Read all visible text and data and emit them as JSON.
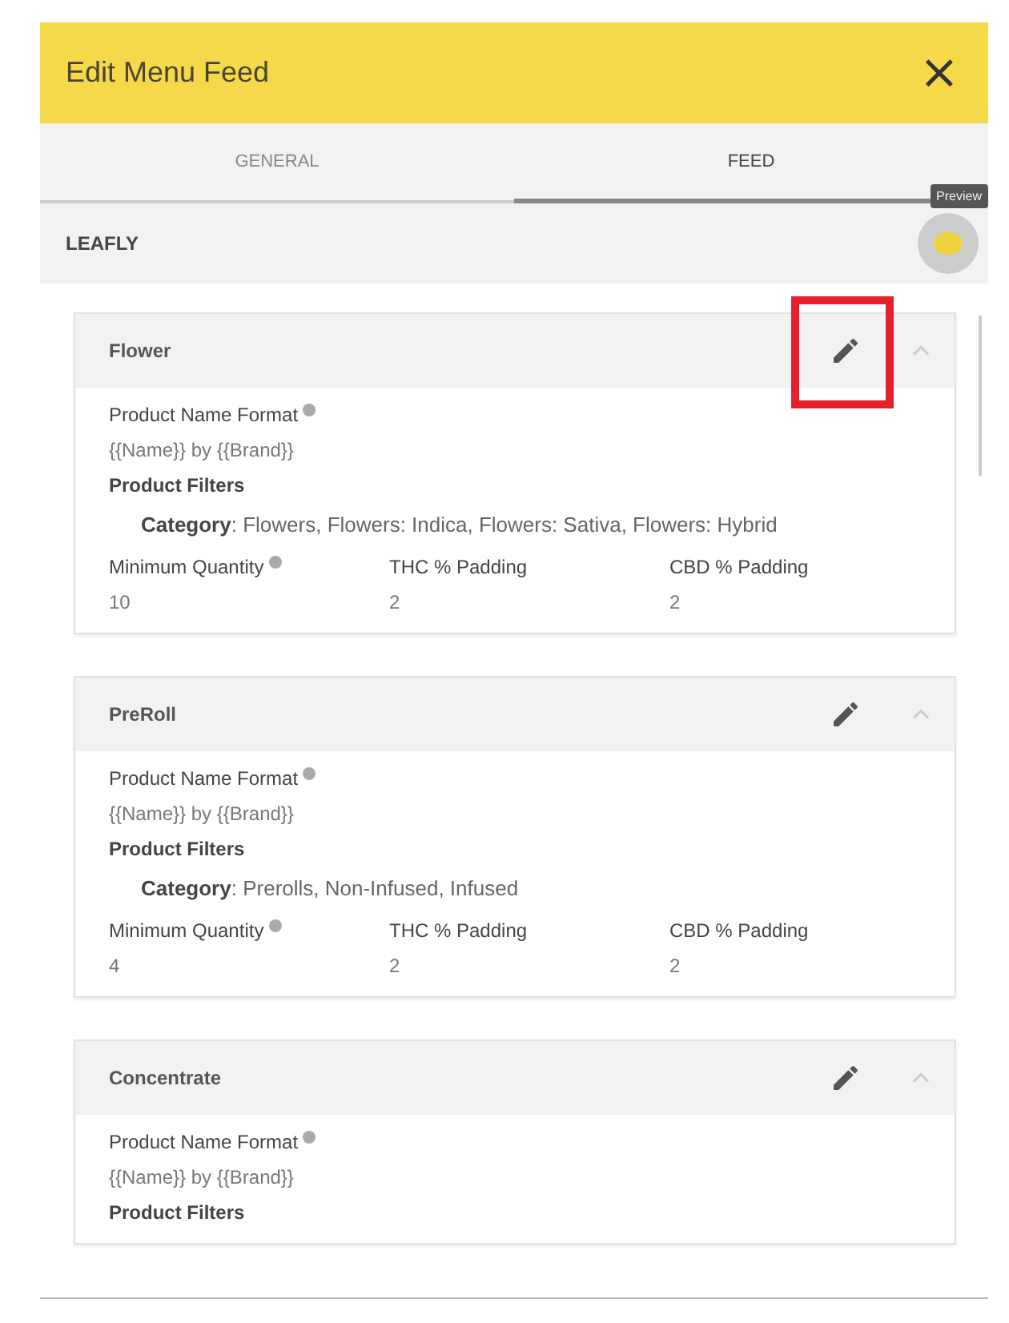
{
  "window": {
    "title": "Edit Menu Feed",
    "close": "×"
  },
  "tabs": [
    {
      "label": "GENERAL",
      "selected": false
    },
    {
      "label": "FEED",
      "selected": true
    }
  ],
  "section": {
    "title": "LEAFLY",
    "tooltip": "Preview"
  },
  "cards": [
    {
      "title": "Flower",
      "expanded": true,
      "edit_highlighted": true,
      "name_format_label": "Product Name Format",
      "name_format": "{{Name}} by {{Brand}}",
      "filters_label": "Product Filters",
      "filter": "**Category**: Flowers, Flowers: Indica, Flowers: Sativa, Flowers: Hybrid",
      "stats": [
        {
          "label": "Minimum Quantity",
          "info": true,
          "value": "10"
        },
        {
          "label": "THC % Padding",
          "info": false,
          "value": "2"
        },
        {
          "label": "CBD % Padding",
          "info": false,
          "value": "2"
        }
      ]
    },
    {
      "title": "PreRoll",
      "expanded": true,
      "edit_highlighted": false,
      "name_format_label": "Product Name Format",
      "name_format": "{{Name}} by {{Brand}}",
      "filters_label": "Product Filters",
      "filter": "**Category**: Prerolls, Non-Infused, Infused",
      "stats": [
        {
          "label": "Minimum Quantity",
          "info": true,
          "value": "4"
        },
        {
          "label": "THC % Padding",
          "info": false,
          "value": "2"
        },
        {
          "label": "CBD % Padding",
          "info": false,
          "value": "2"
        }
      ]
    },
    {
      "title": "Concentrate",
      "expanded": true,
      "edit_highlighted": false,
      "name_format_label": "Product Name Format",
      "name_format": "{{Name}} by {{Brand}}",
      "filters_label": "Product Filters"
    }
  ]
}
